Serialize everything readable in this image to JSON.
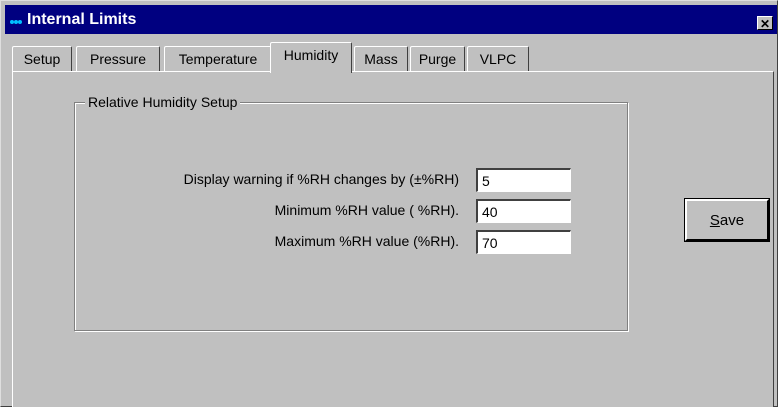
{
  "window": {
    "title": "Internal Limits",
    "close_symbol": "✕",
    "title_icon": "app-icon"
  },
  "tabs": [
    {
      "label": "Setup",
      "active": false
    },
    {
      "label": "Pressure",
      "active": false
    },
    {
      "label": "Temperature",
      "active": false
    },
    {
      "label": "Humidity",
      "active": true
    },
    {
      "label": "Mass",
      "active": false
    },
    {
      "label": "Purge",
      "active": false
    },
    {
      "label": "VLPC",
      "active": false
    }
  ],
  "group": {
    "label": "Relative Humidity Setup"
  },
  "fields": [
    {
      "label": "Display warning if %RH changes by (±%RH)",
      "value": "5"
    },
    {
      "label": "Minimum %RH value ( %RH).",
      "value": "40"
    },
    {
      "label": "Maximum %RH value (%RH).",
      "value": "70"
    }
  ],
  "save_button": {
    "accel": "S",
    "rest": "ave"
  },
  "colors": {
    "titlebar": "#000080",
    "face": "#c0c0c0"
  }
}
